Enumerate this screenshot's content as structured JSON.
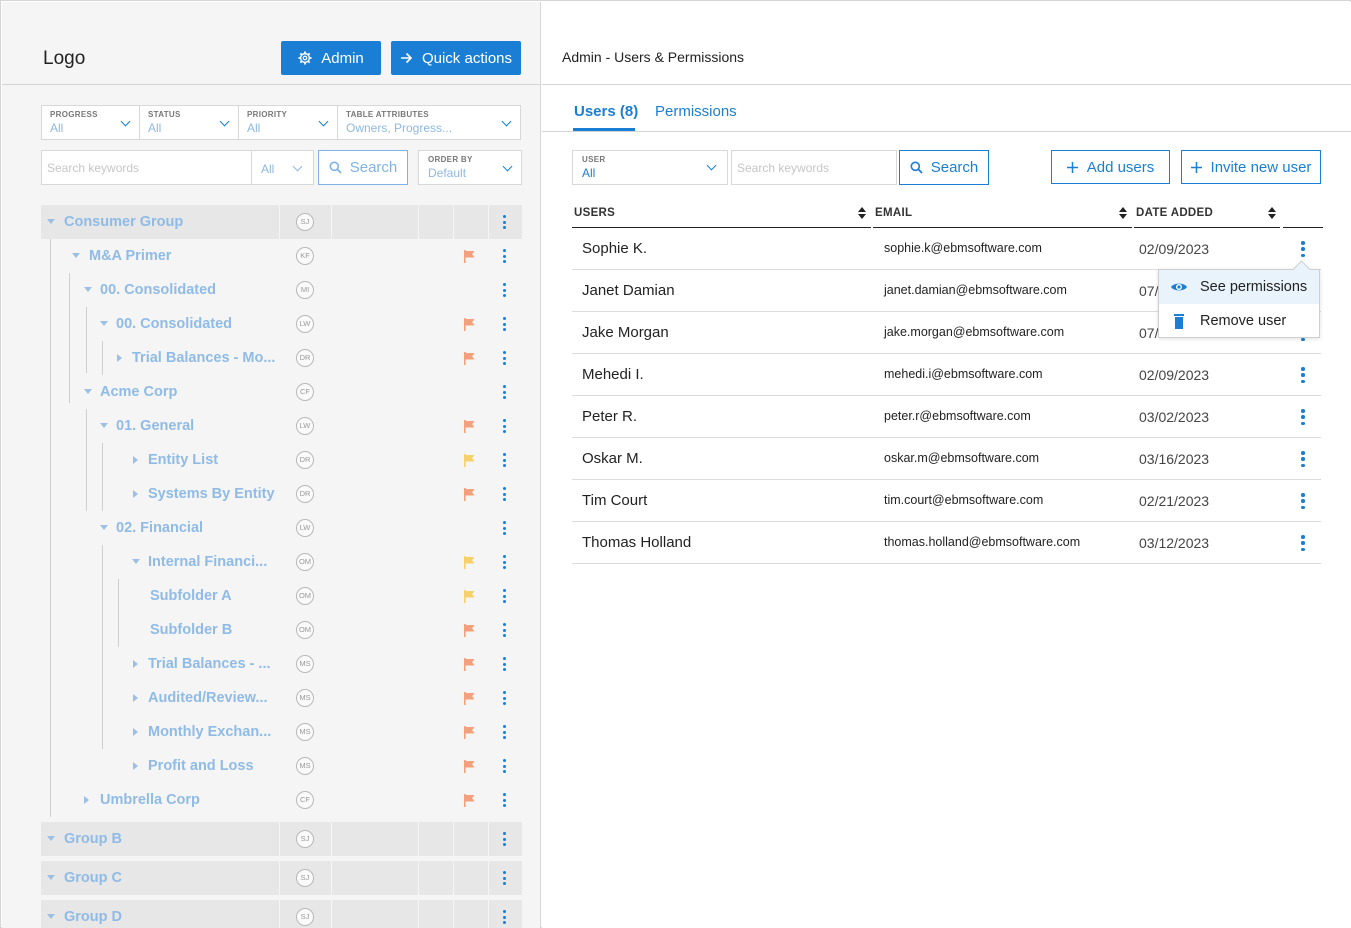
{
  "left": {
    "logo": "Logo",
    "admin_button": "Admin",
    "quick_actions_button": "Quick actions",
    "filters": [
      {
        "label": "PROGRESS",
        "value": "All"
      },
      {
        "label": "STATUS",
        "value": "All"
      },
      {
        "label": "PRIORITY",
        "value": "All"
      },
      {
        "label": "TABLE ATTRIBUTES",
        "value": "Owners, Progress..."
      }
    ],
    "search_placeholder": "Search keywords",
    "search_scope": "All",
    "search_button": "Search",
    "order_by_label": "ORDER BY",
    "order_by_value": "Default",
    "tree": [
      {
        "name": "Consumer Group",
        "initials": "SJ",
        "flag": "",
        "group": true
      },
      {
        "name": "M&A Primer",
        "initials": "KF",
        "flag": "orange"
      },
      {
        "name": "00. Consolidated",
        "initials": "MI",
        "flag": ""
      },
      {
        "name": "00. Consolidated",
        "initials": "LW",
        "flag": "orange"
      },
      {
        "name": "Trial Balances - Mo...",
        "initials": "DR",
        "flag": "orange"
      },
      {
        "name": "Acme Corp",
        "initials": "CF",
        "flag": ""
      },
      {
        "name": "01. General",
        "initials": "LW",
        "flag": "orange"
      },
      {
        "name": "Entity List",
        "initials": "DR",
        "flag": "yellow"
      },
      {
        "name": "Systems By Entity",
        "initials": "DR",
        "flag": "orange"
      },
      {
        "name": "02. Financial",
        "initials": "LW",
        "flag": ""
      },
      {
        "name": "Internal Financi...",
        "initials": "OM",
        "flag": "yellow"
      },
      {
        "name": "Subfolder A",
        "initials": "OM",
        "flag": "yellow"
      },
      {
        "name": "Subfolder B",
        "initials": "OM",
        "flag": "orange"
      },
      {
        "name": "Trial Balances - ...",
        "initials": "MS",
        "flag": "orange"
      },
      {
        "name": "Audited/Review...",
        "initials": "MS",
        "flag": "orange"
      },
      {
        "name": "Monthly Exchan...",
        "initials": "MS",
        "flag": "orange"
      },
      {
        "name": "Profit and Loss",
        "initials": "MS",
        "flag": "orange"
      },
      {
        "name": "Umbrella Corp",
        "initials": "CF",
        "flag": "orange"
      },
      {
        "name": "Group B",
        "initials": "SJ",
        "flag": "",
        "group": true
      },
      {
        "name": "Group C",
        "initials": "SJ",
        "flag": "",
        "group": true
      },
      {
        "name": "Group D",
        "initials": "SJ",
        "flag": "",
        "group": true
      }
    ]
  },
  "right": {
    "title": "Admin - Users & Permissions",
    "tabs": [
      {
        "label": "Users (8)"
      },
      {
        "label": "Permissions"
      }
    ],
    "user_filter_label": "USER",
    "user_filter_value": "All",
    "search_placeholder": "Search keywords",
    "search_button": "Search",
    "add_users_button": "Add users",
    "invite_button": "Invite new user",
    "columns": [
      "USERS",
      "EMAIL",
      "DATE ADDED"
    ],
    "users": [
      {
        "name": "Sophie K.",
        "email": "sophie.k@ebmsoftware.com",
        "date": "02/09/2023"
      },
      {
        "name": "Janet Damian",
        "email": "janet.damian@ebmsoftware.com",
        "date": "07/"
      },
      {
        "name": "Jake Morgan",
        "email": "jake.morgan@ebmsoftware.com",
        "date": "07/"
      },
      {
        "name": "Mehedi I.",
        "email": "mehedi.i@ebmsoftware.com",
        "date": "02/09/2023"
      },
      {
        "name": "Peter R.",
        "email": "peter.r@ebmsoftware.com",
        "date": "03/02/2023"
      },
      {
        "name": "Oskar M.",
        "email": "oskar.m@ebmsoftware.com",
        "date": "03/16/2023"
      },
      {
        "name": "Tim Court",
        "email": "tim.court@ebmsoftware.com",
        "date": "02/21/2023"
      },
      {
        "name": "Thomas Holland",
        "email": "thomas.holland@ebmsoftware.com",
        "date": "03/12/2023"
      }
    ],
    "context_menu": {
      "see_permissions": "See permissions",
      "remove_user": "Remove user"
    }
  },
  "colors": {
    "accent": "#1a7fd4",
    "flag_orange": "#f4a07c",
    "flag_yellow": "#f6d169",
    "tree_text": "#8fbbe6"
  }
}
